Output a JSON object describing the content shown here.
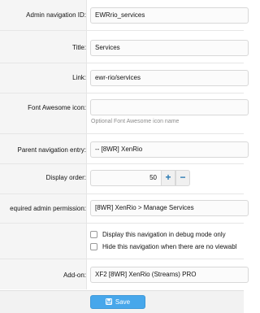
{
  "form": {
    "admin_navigation_id": {
      "label": "Admin navigation ID:",
      "value": "EWRrio_services"
    },
    "title": {
      "label": "Title:",
      "value": "Services"
    },
    "link": {
      "label": "Link:",
      "value": "ewr-rio/services"
    },
    "font_awesome_icon": {
      "label": "Font Awesome icon:",
      "value": "",
      "hint": "Optional Font Awesome icon name"
    },
    "parent_navigation": {
      "label": "Parent navigation entry:",
      "value": "-- [8WR] XenRio"
    },
    "display_order": {
      "label": "Display order:",
      "value": "50",
      "plus": "+",
      "minus": "−"
    },
    "admin_permission": {
      "label": "equired admin permission:",
      "value": "[8WR] XenRio > Manage Services"
    },
    "options": [
      {
        "label": "Display this navigation in debug mode only",
        "checked": false
      },
      {
        "label": "Hide this navigation when there are no viewabl",
        "checked": false
      }
    ],
    "addon": {
      "label": "Add-on:",
      "value": "XF2 [8WR] XenRio (Streams) PRO"
    }
  },
  "footer": {
    "save_label": "Save"
  },
  "colors": {
    "accent": "#47a7eb",
    "stepper_glyph": "#2577b1",
    "label_background": "#f5f5f5"
  },
  "icons": {
    "save": "floppy-disk-icon",
    "plus": "plus-icon",
    "minus": "minus-icon"
  }
}
